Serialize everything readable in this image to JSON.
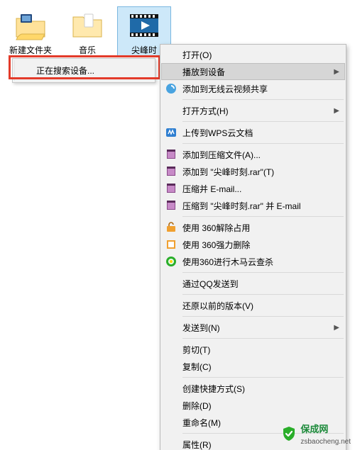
{
  "icons": [
    {
      "label": "新建文件夹"
    },
    {
      "label": "音乐"
    },
    {
      "label": "尖峰时"
    }
  ],
  "flyout": {
    "searching": "正在搜索设备..."
  },
  "menu": {
    "open": "打开(O)",
    "cast": "播放到设备",
    "add_wireless": "添加到无线云视频共享",
    "open_with": "打开方式(H)",
    "wps_upload": "上传到WPS云文档",
    "add_to_archive": "添加到压缩文件(A)...",
    "add_to_rar": "添加到 \"尖峰时刻.rar\"(T)",
    "compress_email": "压缩并 E-mail...",
    "compress_rar_email": "压缩到 \"尖峰时刻.rar\" 并 E-mail",
    "unlock360": "使用 360解除占用",
    "forcedel360": "使用 360强力删除",
    "trojan360": "使用360进行木马云查杀",
    "qq_send": "通过QQ发送到",
    "restore_prev": "还原以前的版本(V)",
    "send_to": "发送到(N)",
    "cut": "剪切(T)",
    "copy": "复制(C)",
    "shortcut": "创建快捷方式(S)",
    "delete": "删除(D)",
    "rename": "重命名(M)",
    "properties": "属性(R)"
  },
  "watermark": {
    "title": "保成网",
    "url": "zsbaocheng.net"
  }
}
